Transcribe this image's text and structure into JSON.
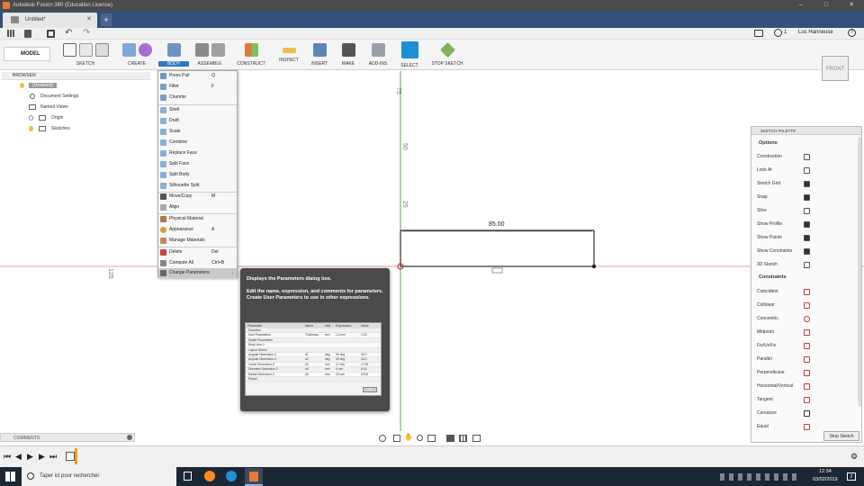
{
  "window": {
    "title": "Autodesk Fusion 360 (Education License)"
  },
  "tab": {
    "name": "Untitled*"
  },
  "user": {
    "name": "Luc Hanneuse",
    "count": "1"
  },
  "ribbon": {
    "workspace": "MODEL",
    "groups": [
      "SKETCH",
      "CREATE",
      "BODY",
      "ASSEMBLE",
      "CONSTRUCT",
      "INSPECT",
      "INSERT",
      "MAKE",
      "ADD-INS",
      "SELECT",
      "STOP SKETCH"
    ]
  },
  "browser": {
    "title": "BROWSER",
    "root": "(Unsaved)",
    "items": [
      "Document Settings",
      "Named Views",
      "Origin",
      "Sketches"
    ]
  },
  "menu": {
    "items": [
      {
        "label": "Press Pull",
        "shortcut": "Q"
      },
      {
        "label": "Fillet",
        "shortcut": "F"
      },
      {
        "label": "Chamfer",
        "shortcut": ""
      },
      {
        "label": "Shell",
        "shortcut": ""
      },
      {
        "label": "Draft",
        "shortcut": ""
      },
      {
        "label": "Scale",
        "shortcut": ""
      },
      {
        "label": "Combine",
        "shortcut": ""
      },
      {
        "label": "Replace Face",
        "shortcut": ""
      },
      {
        "label": "Split Face",
        "shortcut": ""
      },
      {
        "label": "Split Body",
        "shortcut": ""
      },
      {
        "label": "Silhouette Split",
        "shortcut": ""
      },
      {
        "label": "Move/Copy",
        "shortcut": "M"
      },
      {
        "label": "Align",
        "shortcut": ""
      },
      {
        "label": "Physical Material",
        "shortcut": ""
      },
      {
        "label": "Appearance",
        "shortcut": "A"
      },
      {
        "label": "Manage Materials",
        "shortcut": ""
      },
      {
        "label": "Delete",
        "shortcut": "Del"
      },
      {
        "label": "Compute All",
        "shortcut": "Ctrl+B"
      },
      {
        "label": "Change Parameters",
        "shortcut": ""
      }
    ]
  },
  "tooltip": {
    "title": "Displays the Parameters dialog box.",
    "body": "Edit the name, expression, and comments for parameters. Create User Parameters to use in other expressions.",
    "table_headers": [
      "Parameter",
      "Name",
      "Unit",
      "Expression",
      "Value"
    ],
    "rows": [
      {
        "name": "Favorites",
        "n": "",
        "u": "",
        "e": "",
        "v": ""
      },
      {
        "name": "User Parameters",
        "n": "Thickness",
        "u": "mm",
        "e": "1.2 mm",
        "v": "1.20"
      },
      {
        "name": "Model Parameters",
        "n": "",
        "u": "",
        "e": "",
        "v": ""
      },
      {
        "name": "Body Vers 1",
        "n": "",
        "u": "",
        "e": "",
        "v": ""
      },
      {
        "name": "Layout Sketch",
        "n": "",
        "u": "",
        "e": "",
        "v": ""
      },
      {
        "name": "Angular Dimension-3",
        "n": "d1",
        "u": "deg",
        "e": "90 deg",
        "v": "90.0"
      },
      {
        "name": "Angular Dimension-4",
        "n": "d2",
        "u": "deg",
        "e": "30 deg",
        "v": "30.0"
      },
      {
        "name": "Linear Dimension-3",
        "n": "d3",
        "u": "mm",
        "e": "17 mm",
        "v": "17.00"
      },
      {
        "name": "Diameter Dimension-2",
        "n": "d4",
        "u": "mm",
        "e": "6 mm",
        "v": "6.00"
      },
      {
        "name": "Radial Dimension-2",
        "n": "d5",
        "u": "mm",
        "e": "20 mm",
        "v": "20.00"
      },
      {
        "name": "Plane1",
        "n": "",
        "u": "",
        "e": "",
        "v": ""
      }
    ],
    "ok": "OK"
  },
  "canvas": {
    "ruler_top": "75",
    "ruler_mid": "50",
    "ruler_low": "25",
    "ruler_left": "125",
    "dimension": "85.00",
    "viewcube": "FRONT"
  },
  "palette": {
    "title": "SKETCH PALETTE",
    "options_header": "Options",
    "options": [
      {
        "label": "Construction",
        "checked": false
      },
      {
        "label": "Look At",
        "checked": false
      },
      {
        "label": "Sketch Grid",
        "checked": true
      },
      {
        "label": "Snap",
        "checked": true
      },
      {
        "label": "Slice",
        "checked": false
      },
      {
        "label": "Show Profile",
        "checked": true
      },
      {
        "label": "Show Points",
        "checked": true
      },
      {
        "label": "Show Constraints",
        "checked": true
      },
      {
        "label": "3D Sketch",
        "checked": false
      }
    ],
    "constraints_header": "Constraints",
    "constraints": [
      "Coincident",
      "Collinear",
      "Concentric",
      "Midpoint",
      "Fix/UnFix",
      "Parallel",
      "Perpendicular",
      "Horizontal/Vertical",
      "Tangent",
      "Curvature",
      "Equal"
    ],
    "stop": "Stop Sketch"
  },
  "comments": {
    "label": "COMMENTS"
  },
  "taskbar": {
    "search_placeholder": "Taper ici pour rechercher",
    "time": "12:34",
    "date": "03/02/2019",
    "notifications": "2"
  }
}
